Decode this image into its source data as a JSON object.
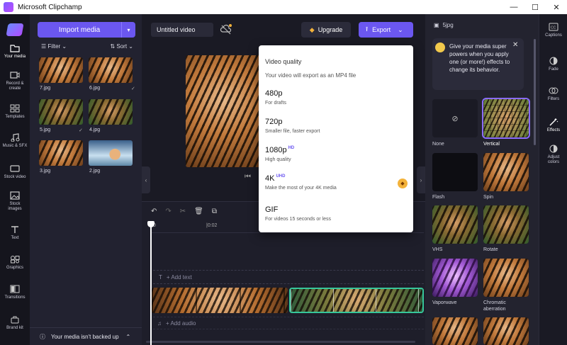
{
  "window": {
    "title": "Microsoft Clipchamp",
    "minimize": "—",
    "maximize": "☐",
    "close": "✕"
  },
  "nav": {
    "items": [
      {
        "label": "Your media"
      },
      {
        "label": "Record & create"
      },
      {
        "label": "Templates"
      },
      {
        "label": "Music & SFX"
      },
      {
        "label": "Stock video"
      },
      {
        "label": "Stock images"
      },
      {
        "label": "Text"
      },
      {
        "label": "Graphics"
      },
      {
        "label": "Transitions"
      },
      {
        "label": "Brand kit"
      }
    ]
  },
  "media": {
    "import_label": "Import media",
    "filter_label": "Filter",
    "sort_label": "Sort",
    "items": [
      {
        "name": "7.jpg",
        "checked": false
      },
      {
        "name": "6.jpg",
        "checked": true
      },
      {
        "name": "5.jpg",
        "checked": true
      },
      {
        "name": "4.jpg",
        "checked": false
      },
      {
        "name": "3.jpg",
        "checked": false
      },
      {
        "name": "2.jpg",
        "checked": false
      }
    ],
    "backup_text": "Your media isn't backed up"
  },
  "toolbar": {
    "project_name": "Untitled video",
    "upgrade_label": "Upgrade",
    "export_label": "Export"
  },
  "timeline": {
    "ruler": {
      "t0": "0",
      "t1": "|0:02"
    },
    "text_track": "+ Add text",
    "audio_track": "+ Add audio"
  },
  "export_menu": {
    "title": "Video quality",
    "subtitle": "Your video will export as an MP4 file",
    "options": [
      {
        "name": "480p",
        "badge": "",
        "desc": "For drafts"
      },
      {
        "name": "720p",
        "badge": "",
        "desc": "Smaller file, faster export"
      },
      {
        "name": "1080p",
        "badge": "HD",
        "desc": "High quality"
      },
      {
        "name": "4K",
        "badge": "UHD",
        "desc": "Make the most of your 4K media"
      },
      {
        "name": "GIF",
        "badge": "",
        "desc": "For videos 15 seconds or less"
      }
    ]
  },
  "effects": {
    "header": "5jpg",
    "tip": "Give your media super powers when you apply one (or more!) effects to change its behavior.",
    "tiles": [
      {
        "label": "None"
      },
      {
        "label": "Vertical"
      },
      {
        "label": "Flash"
      },
      {
        "label": "Spin"
      },
      {
        "label": "VHS"
      },
      {
        "label": "Rotate"
      },
      {
        "label": "Vaporwave"
      },
      {
        "label": "Chromatic aberration"
      }
    ]
  },
  "right_rail": {
    "items": [
      {
        "label": "Captions"
      },
      {
        "label": "Fade"
      },
      {
        "label": "Filters"
      },
      {
        "label": "Effects"
      },
      {
        "label": "Adjust colors"
      }
    ]
  },
  "colors": {
    "accent": "#6b57f0",
    "selected_clip": "#36c69a",
    "premium": "#f3b23a"
  }
}
